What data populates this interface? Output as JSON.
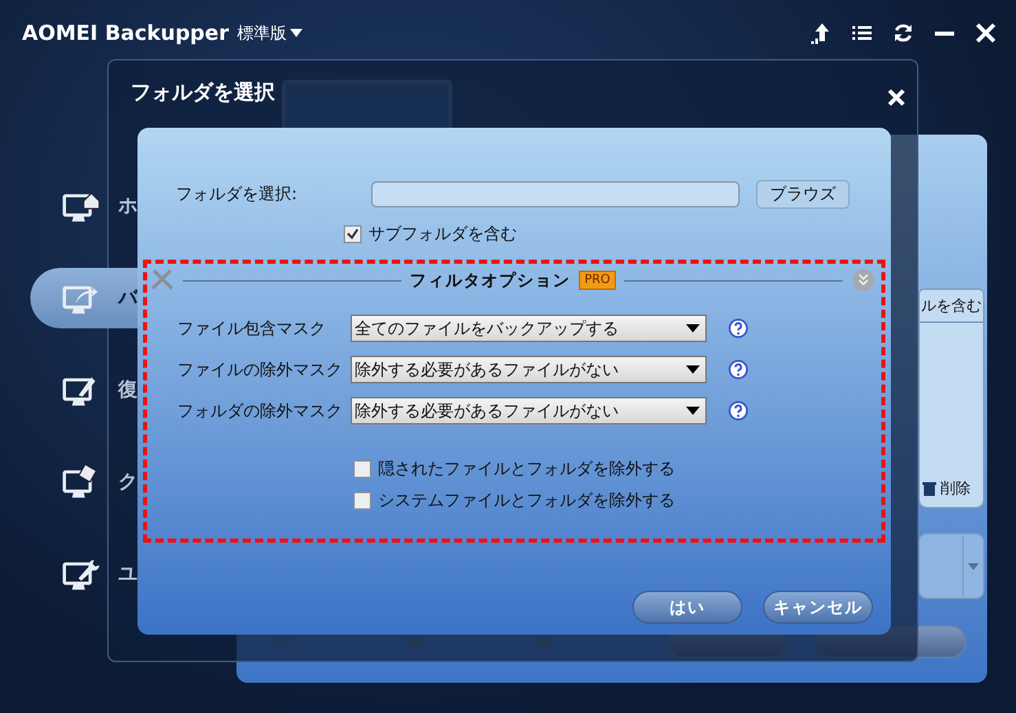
{
  "app": {
    "title": "AOMEI Backupper",
    "edition": "標準版"
  },
  "sidebar": {
    "items": [
      {
        "label": "ホ",
        "selected": false
      },
      {
        "label": "バ",
        "selected": true
      },
      {
        "label": "復",
        "selected": false
      },
      {
        "label": "ク",
        "selected": false
      },
      {
        "label": "ユ",
        "selected": false
      }
    ]
  },
  "background_panel": {
    "column_text": "ルを含む",
    "delete_label": "削除"
  },
  "dialog": {
    "title": "フォルダを選択"
  },
  "folder_select": {
    "label": "フォルダを選択:",
    "browse_button": "ブラウズ",
    "include_subfolders": {
      "label": "サブフォルダを含む",
      "checked": true
    }
  },
  "filter": {
    "title": "フィルタオプション",
    "badge": "PRO",
    "masks": [
      {
        "label": "ファイル包含マスク",
        "value": "全てのファイルをバックアップする"
      },
      {
        "label": "ファイルの除外マスク",
        "value": "除外する必要があるファイルがない"
      },
      {
        "label": "フォルダの除外マスク",
        "value": "除外する必要があるファイルがない"
      }
    ],
    "options": [
      {
        "label": "隠されたファイルとフォルダを除外する",
        "checked": false
      },
      {
        "label": "システムファイルとフォルダを除外する",
        "checked": false
      }
    ]
  },
  "buttons": [
    {
      "label": "はい"
    },
    {
      "label": "キャンセル"
    }
  ]
}
